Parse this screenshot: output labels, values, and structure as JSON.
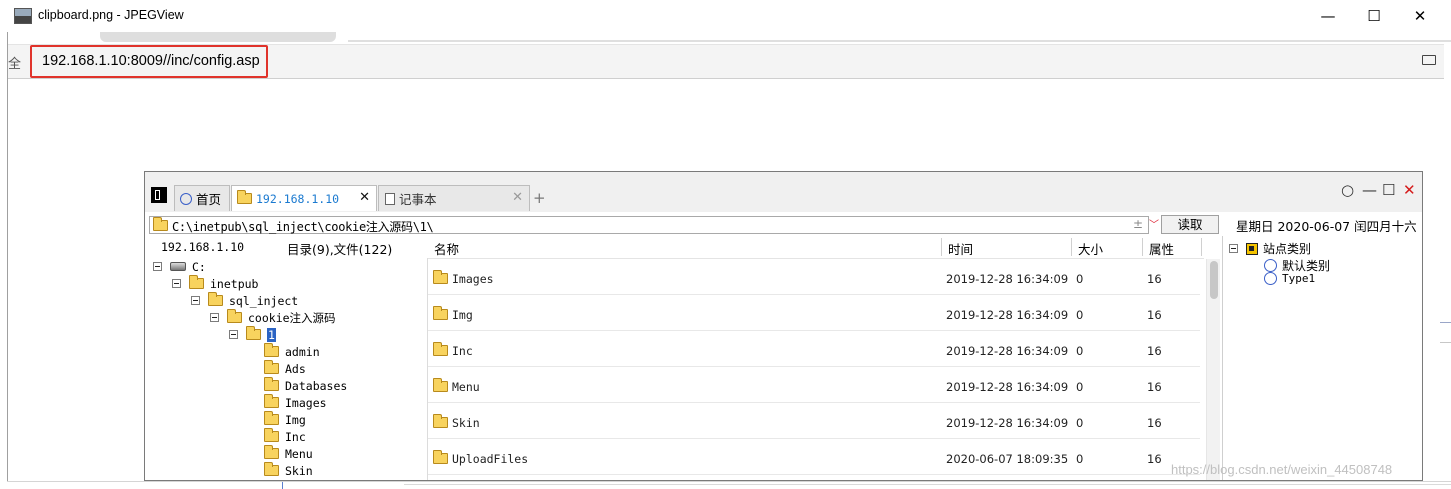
{
  "window": {
    "title": "clipboard.png - JPEGView",
    "controls": {
      "minimize": "—",
      "maximize": "☐",
      "close": "✕"
    }
  },
  "browser": {
    "secure_label": "全",
    "url": "192.168.1.10:8009//inc/config.asp",
    "highlight_color": "#e0332b"
  },
  "file_manager": {
    "tabs": [
      {
        "label": "首页",
        "icon": "home-circle-icon"
      },
      {
        "label": "192.168.1.10",
        "icon": "folder-icon",
        "close": "✕",
        "active": true
      },
      {
        "label": "记事本",
        "icon": "document-icon",
        "close": "✕"
      }
    ],
    "add_tab": "+",
    "controls": {
      "circle": "○",
      "minimize": "—",
      "maximize": "☐",
      "close": "✕"
    },
    "path": "C:\\inetpub\\sql_inject\\cookie注入源码\\1\\",
    "path_favorite": "±",
    "path_dropdown": "﹀",
    "read_button": "读取",
    "date": "星期日  2020-06-07  闰四月十六",
    "ip": "192.168.1.10",
    "count": "目录(9),文件(122)",
    "columns": {
      "name": "名称",
      "time": "时间",
      "size": "大小",
      "attr": "属性"
    },
    "tree": {
      "drive": "C:",
      "inetpub": "inetpub",
      "sql_inject": "sql_inject",
      "cookie": "cookie注入源码",
      "selected": "1",
      "children": [
        "admin",
        "Ads",
        "Databases",
        "Images",
        "Img",
        "Inc",
        "Menu",
        "Skin"
      ]
    },
    "files": [
      {
        "name": "Images",
        "time": "2019-12-28 16:34:09",
        "size": "0",
        "attr": "16"
      },
      {
        "name": "Img",
        "time": "2019-12-28 16:34:09",
        "size": "0",
        "attr": "16"
      },
      {
        "name": "Inc",
        "time": "2019-12-28 16:34:09",
        "size": "0",
        "attr": "16"
      },
      {
        "name": "Menu",
        "time": "2019-12-28 16:34:09",
        "size": "0",
        "attr": "16"
      },
      {
        "name": "Skin",
        "time": "2019-12-28 16:34:09",
        "size": "0",
        "attr": "16"
      },
      {
        "name": "UploadFiles",
        "time": "2020-06-07 18:09:35",
        "size": "0",
        "attr": "16"
      }
    ],
    "categories": {
      "root": "站点类别",
      "items": [
        "默认类别",
        "Type1"
      ]
    }
  },
  "watermark": "https://blog.csdn.net/weixin_44508748"
}
